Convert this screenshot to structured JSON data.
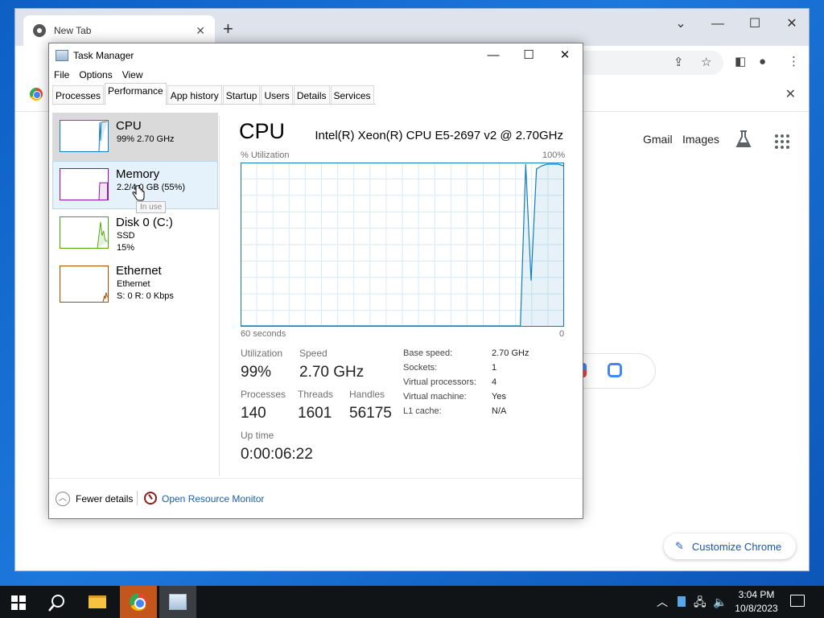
{
  "chrome": {
    "tab_title": "New Tab",
    "new_tab": "+",
    "minimize": "⌄",
    "restore": "☐",
    "close": "✕",
    "header_links": [
      "Gmail",
      "Images"
    ],
    "customize_label": "Customize Chrome"
  },
  "task_manager": {
    "title": "Task Manager",
    "menu": [
      "File",
      "Options",
      "View"
    ],
    "tabs": [
      "Processes",
      "Performance",
      "App history",
      "Startup",
      "Users",
      "Details",
      "Services"
    ],
    "active_tab": "Performance",
    "resources": [
      {
        "name": "CPU",
        "line1": "99%  2.70 GHz",
        "line2": "",
        "color": "#117dbb"
      },
      {
        "name": "Memory",
        "line1": "2.2/4.0 GB (55%)",
        "line2": "",
        "color": "#8b12ae"
      },
      {
        "name": "Disk 0 (C:)",
        "line1": "SSD",
        "line2": "15%",
        "color": "#4da60c"
      },
      {
        "name": "Ethernet",
        "line1": "Ethernet",
        "line2": "S: 0  R: 0 Kbps",
        "color": "#a74f01"
      }
    ],
    "tooltip": "In use",
    "detail": {
      "title": "CPU",
      "model": "Intel(R) Xeon(R) CPU E5-2697 v2 @ 2.70GHz",
      "y_label": "% Utilization",
      "y_max": "100%",
      "x_left": "60 seconds",
      "x_right": "0",
      "stats": {
        "utilization_label": "Utilization",
        "utilization": "99%",
        "speed_label": "Speed",
        "speed": "2.70 GHz",
        "processes_label": "Processes",
        "processes": "140",
        "threads_label": "Threads",
        "threads": "1601",
        "handles_label": "Handles",
        "handles": "56175",
        "uptime_label": "Up time",
        "uptime": "0:00:06:22"
      },
      "info": [
        {
          "label": "Base speed:",
          "value": "2.70 GHz"
        },
        {
          "label": "Sockets:",
          "value": "1"
        },
        {
          "label": "Virtual processors:",
          "value": "4"
        },
        {
          "label": "Virtual machine:",
          "value": "Yes"
        },
        {
          "label": "L1 cache:",
          "value": "N/A"
        }
      ]
    },
    "footer": {
      "fewer_details": "Fewer details",
      "open_resmon": "Open Resource Monitor"
    }
  },
  "taskbar": {
    "time": "3:04 PM",
    "date": "10/8/2023"
  },
  "chart_data": {
    "type": "line",
    "title": "",
    "xlabel": "60 seconds",
    "ylabel": "% Utilization",
    "ylim": [
      0,
      100
    ],
    "x": [
      0,
      1,
      2,
      3,
      4,
      5,
      6,
      7,
      8,
      9,
      10,
      11,
      12,
      13,
      14,
      15,
      16,
      17,
      18,
      19,
      20,
      21,
      22,
      23,
      24,
      25,
      26,
      27,
      28,
      29,
      30,
      31,
      32,
      33,
      34,
      35,
      36,
      37,
      38,
      39,
      40,
      41,
      42,
      43,
      44,
      45,
      46,
      47,
      48,
      49,
      50,
      51,
      52,
      53,
      54,
      55,
      56,
      57,
      58,
      59,
      60
    ],
    "series": [
      {
        "values": [
          0,
          0,
          0,
          0,
          0,
          0,
          0,
          0,
          0,
          0,
          0,
          0,
          0,
          0,
          0,
          0,
          0,
          0,
          0,
          0,
          0,
          0,
          0,
          0,
          0,
          0,
          0,
          0,
          0,
          0,
          0,
          0,
          0,
          0,
          0,
          0,
          0,
          0,
          0,
          0,
          0,
          0,
          0,
          0,
          0,
          0,
          0,
          0,
          0,
          0,
          0,
          0,
          0,
          100,
          28,
          97,
          99,
          100,
          100,
          100,
          99
        ]
      }
    ]
  }
}
